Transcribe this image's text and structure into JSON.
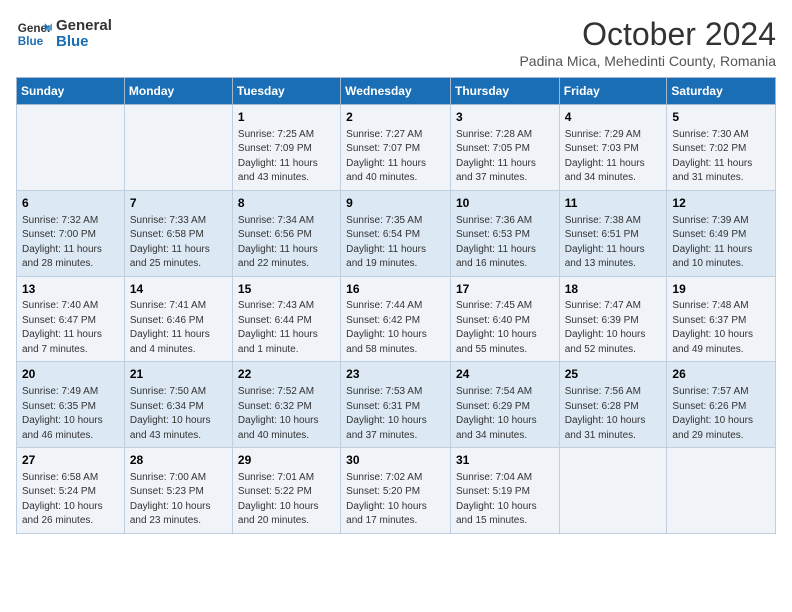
{
  "logo": {
    "text_general": "General",
    "text_blue": "Blue"
  },
  "header": {
    "month": "October 2024",
    "location": "Padina Mica, Mehedinti County, Romania"
  },
  "days_of_week": [
    "Sunday",
    "Monday",
    "Tuesday",
    "Wednesday",
    "Thursday",
    "Friday",
    "Saturday"
  ],
  "weeks": [
    [
      {
        "day": "",
        "info": ""
      },
      {
        "day": "",
        "info": ""
      },
      {
        "day": "1",
        "info": "Sunrise: 7:25 AM\nSunset: 7:09 PM\nDaylight: 11 hours and 43 minutes."
      },
      {
        "day": "2",
        "info": "Sunrise: 7:27 AM\nSunset: 7:07 PM\nDaylight: 11 hours and 40 minutes."
      },
      {
        "day": "3",
        "info": "Sunrise: 7:28 AM\nSunset: 7:05 PM\nDaylight: 11 hours and 37 minutes."
      },
      {
        "day": "4",
        "info": "Sunrise: 7:29 AM\nSunset: 7:03 PM\nDaylight: 11 hours and 34 minutes."
      },
      {
        "day": "5",
        "info": "Sunrise: 7:30 AM\nSunset: 7:02 PM\nDaylight: 11 hours and 31 minutes."
      }
    ],
    [
      {
        "day": "6",
        "info": "Sunrise: 7:32 AM\nSunset: 7:00 PM\nDaylight: 11 hours and 28 minutes."
      },
      {
        "day": "7",
        "info": "Sunrise: 7:33 AM\nSunset: 6:58 PM\nDaylight: 11 hours and 25 minutes."
      },
      {
        "day": "8",
        "info": "Sunrise: 7:34 AM\nSunset: 6:56 PM\nDaylight: 11 hours and 22 minutes."
      },
      {
        "day": "9",
        "info": "Sunrise: 7:35 AM\nSunset: 6:54 PM\nDaylight: 11 hours and 19 minutes."
      },
      {
        "day": "10",
        "info": "Sunrise: 7:36 AM\nSunset: 6:53 PM\nDaylight: 11 hours and 16 minutes."
      },
      {
        "day": "11",
        "info": "Sunrise: 7:38 AM\nSunset: 6:51 PM\nDaylight: 11 hours and 13 minutes."
      },
      {
        "day": "12",
        "info": "Sunrise: 7:39 AM\nSunset: 6:49 PM\nDaylight: 11 hours and 10 minutes."
      }
    ],
    [
      {
        "day": "13",
        "info": "Sunrise: 7:40 AM\nSunset: 6:47 PM\nDaylight: 11 hours and 7 minutes."
      },
      {
        "day": "14",
        "info": "Sunrise: 7:41 AM\nSunset: 6:46 PM\nDaylight: 11 hours and 4 minutes."
      },
      {
        "day": "15",
        "info": "Sunrise: 7:43 AM\nSunset: 6:44 PM\nDaylight: 11 hours and 1 minute."
      },
      {
        "day": "16",
        "info": "Sunrise: 7:44 AM\nSunset: 6:42 PM\nDaylight: 10 hours and 58 minutes."
      },
      {
        "day": "17",
        "info": "Sunrise: 7:45 AM\nSunset: 6:40 PM\nDaylight: 10 hours and 55 minutes."
      },
      {
        "day": "18",
        "info": "Sunrise: 7:47 AM\nSunset: 6:39 PM\nDaylight: 10 hours and 52 minutes."
      },
      {
        "day": "19",
        "info": "Sunrise: 7:48 AM\nSunset: 6:37 PM\nDaylight: 10 hours and 49 minutes."
      }
    ],
    [
      {
        "day": "20",
        "info": "Sunrise: 7:49 AM\nSunset: 6:35 PM\nDaylight: 10 hours and 46 minutes."
      },
      {
        "day": "21",
        "info": "Sunrise: 7:50 AM\nSunset: 6:34 PM\nDaylight: 10 hours and 43 minutes."
      },
      {
        "day": "22",
        "info": "Sunrise: 7:52 AM\nSunset: 6:32 PM\nDaylight: 10 hours and 40 minutes."
      },
      {
        "day": "23",
        "info": "Sunrise: 7:53 AM\nSunset: 6:31 PM\nDaylight: 10 hours and 37 minutes."
      },
      {
        "day": "24",
        "info": "Sunrise: 7:54 AM\nSunset: 6:29 PM\nDaylight: 10 hours and 34 minutes."
      },
      {
        "day": "25",
        "info": "Sunrise: 7:56 AM\nSunset: 6:28 PM\nDaylight: 10 hours and 31 minutes."
      },
      {
        "day": "26",
        "info": "Sunrise: 7:57 AM\nSunset: 6:26 PM\nDaylight: 10 hours and 29 minutes."
      }
    ],
    [
      {
        "day": "27",
        "info": "Sunrise: 6:58 AM\nSunset: 5:24 PM\nDaylight: 10 hours and 26 minutes."
      },
      {
        "day": "28",
        "info": "Sunrise: 7:00 AM\nSunset: 5:23 PM\nDaylight: 10 hours and 23 minutes."
      },
      {
        "day": "29",
        "info": "Sunrise: 7:01 AM\nSunset: 5:22 PM\nDaylight: 10 hours and 20 minutes."
      },
      {
        "day": "30",
        "info": "Sunrise: 7:02 AM\nSunset: 5:20 PM\nDaylight: 10 hours and 17 minutes."
      },
      {
        "day": "31",
        "info": "Sunrise: 7:04 AM\nSunset: 5:19 PM\nDaylight: 10 hours and 15 minutes."
      },
      {
        "day": "",
        "info": ""
      },
      {
        "day": "",
        "info": ""
      }
    ]
  ]
}
